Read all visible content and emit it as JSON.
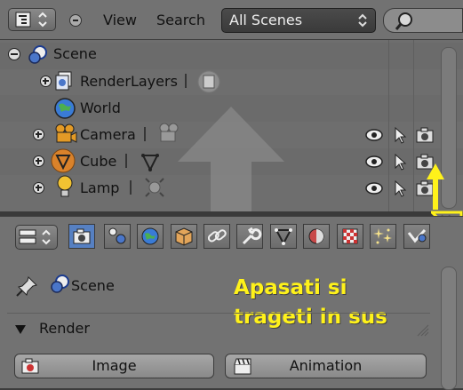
{
  "outliner": {
    "menu_view": "View",
    "menu_search": "Search",
    "scene_select": "All Scenes",
    "tree": {
      "scene": "Scene",
      "render_layers": "RenderLayers",
      "world": "World",
      "camera": "Camera",
      "cube": "Cube",
      "lamp": "Lamp"
    }
  },
  "properties": {
    "context_scene": "Scene",
    "panel_render": "Render",
    "button_image": "Image",
    "button_animation": "Animation"
  },
  "annotation": {
    "line1": "Apasati si",
    "line2": "trageti in sus"
  },
  "colors": {
    "annotation": "#fff21a",
    "active_tab": "#5680c2"
  }
}
